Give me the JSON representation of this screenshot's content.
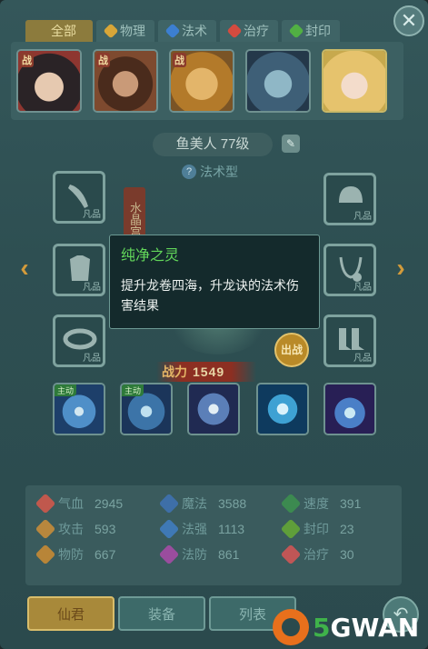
{
  "tabs": [
    {
      "label": "全部",
      "active": true
    },
    {
      "label": "物理",
      "active": false,
      "icon": "physical-icon",
      "color": "#d8a638"
    },
    {
      "label": "法术",
      "active": false,
      "icon": "magic-icon",
      "color": "#3c7fd0"
    },
    {
      "label": "治疗",
      "active": false,
      "icon": "heal-icon",
      "color": "#d44b3f"
    },
    {
      "label": "封印",
      "active": false,
      "icon": "seal-icon",
      "color": "#51b043"
    }
  ],
  "pets": [
    {
      "badge": "战",
      "icon": "black-haired-warrior-portrait"
    },
    {
      "badge": "战",
      "icon": "bearded-general-portrait"
    },
    {
      "badge": "战",
      "icon": "lion-beast-portrait"
    },
    {
      "icon": "blue-beast-portrait"
    },
    {
      "icon": "blonde-mermaid-portrait",
      "selected": true
    }
  ],
  "pet": {
    "name": "鱼美人",
    "level": "77级",
    "type": "法术型",
    "side_label": "水晶宫"
  },
  "equipment": {
    "grade": "凡品",
    "slots": [
      "weapon-icon",
      "armor-icon",
      "belt-icon",
      "helmet-icon",
      "necklace-icon",
      "boots-icon"
    ]
  },
  "battle_button": "出战",
  "power": {
    "label": "战力",
    "value": "1549"
  },
  "tooltip": {
    "title": "纯净之灵",
    "desc": "提升龙卷四海，升龙诀的法术伤害结果"
  },
  "skills": [
    {
      "auto_label": "主动",
      "icon": "whirlwind-skill-icon"
    },
    {
      "auto_label": "主动",
      "icon": "dragon-skill-icon"
    },
    {
      "icon": "spirit-skill-icon"
    },
    {
      "icon": "water-drop-skill-icon"
    },
    {
      "icon": "water-flame-skill-icon"
    }
  ],
  "stats": [
    {
      "label": "气血",
      "value": "2945",
      "color": "#c0584d"
    },
    {
      "label": "魔法",
      "value": "3588",
      "color": "#3e6fa8"
    },
    {
      "label": "速度",
      "value": "391",
      "color": "#3c8a50"
    },
    {
      "label": "攻击",
      "value": "593",
      "color": "#b8873d"
    },
    {
      "label": "法强",
      "value": "1113",
      "color": "#3f79b5"
    },
    {
      "label": "封印",
      "value": "23",
      "color": "#5f9e3a"
    },
    {
      "label": "物防",
      "value": "667",
      "color": "#b88538"
    },
    {
      "label": "法防",
      "value": "861",
      "color": "#9a4d9e"
    },
    {
      "label": "治疗",
      "value": "30",
      "color": "#c05656"
    }
  ],
  "bottom_buttons": [
    "仙君",
    "装备",
    "列表"
  ],
  "watermark": {
    "five": "5",
    "rest": "GWAN"
  }
}
